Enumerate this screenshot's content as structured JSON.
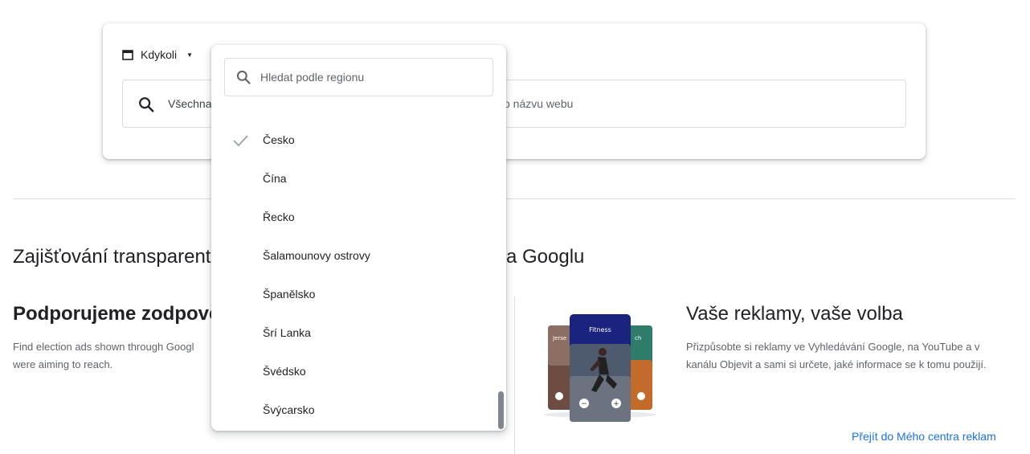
{
  "filters": {
    "date_label": "Kdykoli"
  },
  "search": {
    "text_left": "Všechna",
    "text_right": "o názvu webu"
  },
  "intro": {
    "title_left": "Zajišťování transparent",
    "title_right": "a Googlu"
  },
  "left_card": {
    "heading": "Podporujeme zodpově",
    "text_line1": "Find election ads shown through Googl",
    "text_line2": "were aiming to reach."
  },
  "right_card": {
    "image_label": "Fitness",
    "side_left_label": "Jerse",
    "side_right_label": "ch",
    "heading": "Vaše reklamy, vaše volba",
    "text": "Přizpůsobte si reklamy ve Vyhledávání Google, na YouTube a v kanálu Objevit a sami si určete, jaké informace se k tomu použijí.",
    "link": "Přejít do Mého centra reklam"
  },
  "region_dropdown": {
    "search_placeholder": "Hledat podle regionu",
    "items": [
      {
        "label": "Česko",
        "selected": true
      },
      {
        "label": "Čína",
        "selected": false
      },
      {
        "label": "Řecko",
        "selected": false
      },
      {
        "label": "Šalamounovy ostrovy",
        "selected": false
      },
      {
        "label": "Španělsko",
        "selected": false
      },
      {
        "label": "Šrí Lanka",
        "selected": false
      },
      {
        "label": "Švédsko",
        "selected": false
      },
      {
        "label": "Švýcarsko",
        "selected": false
      }
    ]
  },
  "colors": {
    "accent": "#1a73e8",
    "border": "#dadce0",
    "text_secondary": "#5f6368"
  }
}
